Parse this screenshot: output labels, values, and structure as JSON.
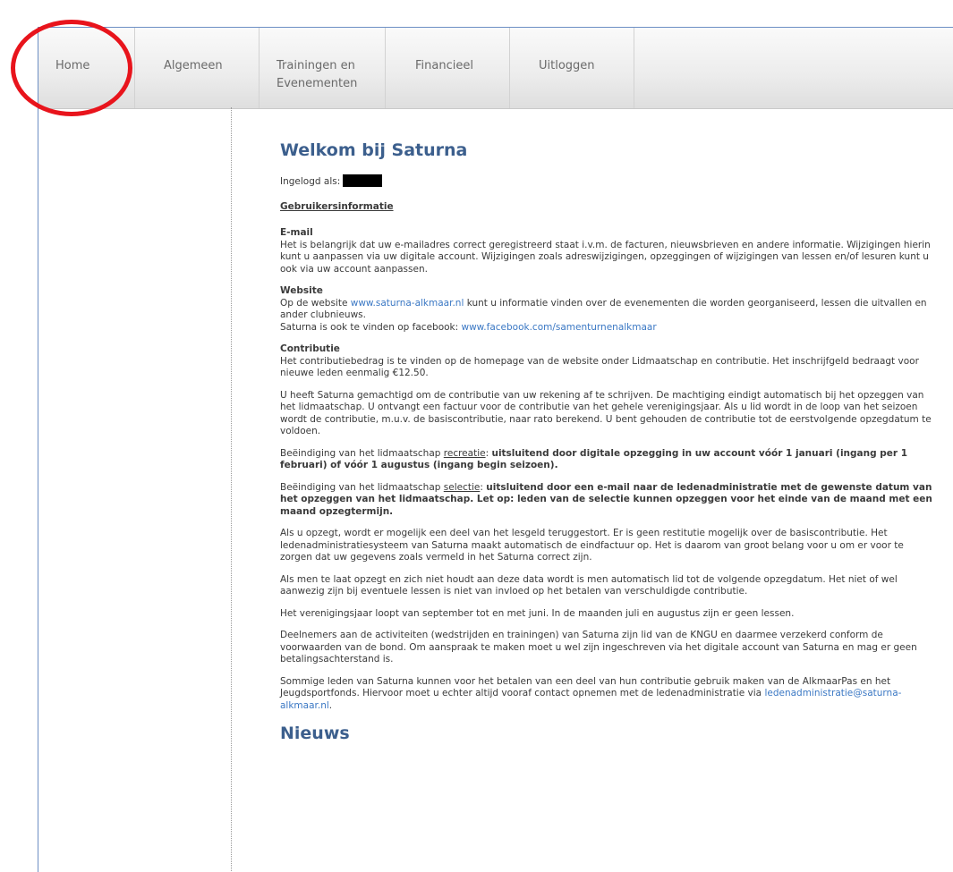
{
  "nav": {
    "home": "Home",
    "algemeen": "Algemeen",
    "trainingen_line1": "Trainingen en",
    "trainingen_line2": "Evenementen",
    "financieel": "Financieel",
    "uitloggen": "Uitloggen"
  },
  "welcome": {
    "title": "Welkom bij Saturna",
    "logged_in_label": "Ingelogd als:",
    "subtitle": "Gebruikersinformatie"
  },
  "email": {
    "heading": "E-mail",
    "text": "Het is belangrijk dat uw e-mailadres correct geregistreerd staat i.v.m. de facturen, nieuwsbrieven en andere informatie. Wijzigingen hierin kunt u aanpassen via uw digitale account. Wijzigingen zoals adreswijzigingen, opzeggingen of wijzigingen van lessen en/of lesuren kunt u ook via uw account aanpassen."
  },
  "website": {
    "heading": "Website",
    "text_before": "Op de website ",
    "link": "www.saturna-alkmaar.nl",
    "text_after": " kunt u informatie vinden over de evenementen die worden georganiseerd, lessen die uitvallen en ander clubnieuws.",
    "facebook_text": "Saturna is ook te vinden op facebook: ",
    "facebook_link": "www.facebook.com/samenturnenalkmaar"
  },
  "contributie": {
    "heading": "Contributie",
    "p1": "Het contributiebedrag is te vinden op de homepage van de website onder Lidmaatschap en contributie. Het inschrijfgeld bedraagt voor nieuwe leden eenmalig €12.50.",
    "p2": "U heeft Saturna gemachtigd om de contributie van uw rekening af te schrijven. De machtiging eindigt automatisch bij het opzeggen van het lidmaatschap. U ontvangt een factuur voor de contributie van het gehele verenigingsjaar. Als u lid wordt in de loop van het seizoen wordt de contributie, m.u.v. de basiscontributie, naar rato berekend. U bent gehouden de contributie tot de eerstvolgende opzegdatum te voldoen.",
    "p3_before": "Beëindiging van het lidmaatschap ",
    "p3_underline": "recreatie",
    "p3_colon": ": ",
    "p3_bold": "uitsluitend door digitale opzegging in uw account vóór 1 januari (ingang per 1 februari) of vóór 1 augustus (ingang begin seizoen).",
    "p4_before": "Beëindiging van het lidmaatschap ",
    "p4_underline": "selectie",
    "p4_colon": ": ",
    "p4_bold": "uitsluitend door een e-mail naar de ledenadministratie met de gewenste datum van het opzeggen van het lidmaatschap. Let op: leden van de selectie kunnen opzeggen voor het einde van de maand met een maand opzegtermijn.",
    "p5": "Als u opzegt, wordt er mogelijk een deel van het lesgeld teruggestort. Er is geen restitutie mogelijk over de basiscontributie. Het ledenadministratiesysteem van Saturna maakt automatisch de eindfactuur op. Het is daarom van groot belang voor u om er voor te zorgen dat uw gegevens zoals vermeld in het Saturna correct zijn.",
    "p6": "Als men te laat opzegt en zich niet houdt aan deze data wordt is men automatisch lid tot de volgende opzegdatum. Het niet of wel aanwezig zijn bij eventuele lessen is niet van invloed op het betalen van verschuldigde contributie.",
    "p7": "Het verenigingsjaar loopt van september tot en met juni. In de maanden juli en augustus zijn er geen lessen.",
    "p8": "Deelnemers aan de activiteiten (wedstrijden en trainingen) van Saturna zijn lid van de KNGU en daarmee verzekerd conform de voorwaarden van de bond. Om aanspraak te maken moet u wel zijn ingeschreven via het digitale account van Saturna en mag er geen betalingsachterstand is.",
    "p9_before": "Sommige leden van Saturna kunnen voor het betalen van een deel van hun contributie gebruik maken van de AlkmaarPas en het Jeugdsportfonds. Hiervoor moet u echter altijd vooraf contact opnemen met de ledenadministratie via ",
    "p9_link": "ledenadministratie@saturna-alkmaar.nl",
    "p9_after": "."
  },
  "news": {
    "title": "Nieuws"
  },
  "colors": {
    "heading": "#3c5f8d",
    "link": "#3b78c4",
    "circle": "#e8141c",
    "frame_border": "#6d8fc4"
  }
}
